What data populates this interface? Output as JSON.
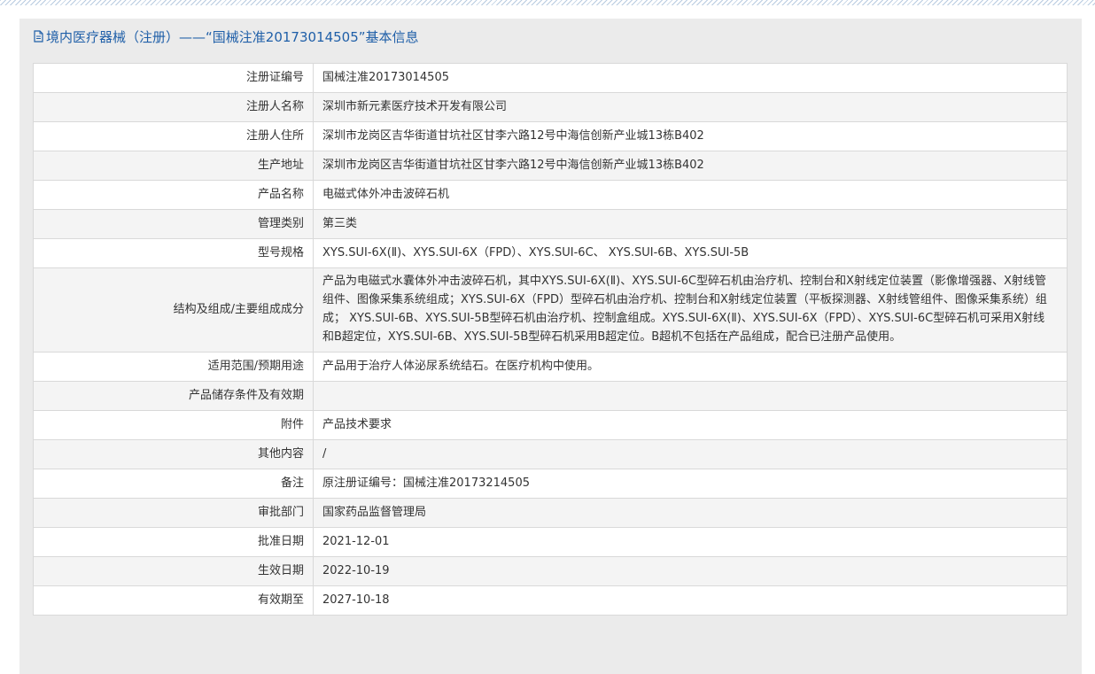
{
  "header": {
    "title": "境内医疗器械（注册）——“国械注准20173014505”基本信息"
  },
  "rows": [
    {
      "label": "注册证编号",
      "value": "国械注准20173014505"
    },
    {
      "label": "注册人名称",
      "value": "深圳市新元素医疗技术开发有限公司"
    },
    {
      "label": "注册人住所",
      "value": "深圳市龙岗区吉华街道甘坑社区甘李六路12号中海信创新产业城13栋B402"
    },
    {
      "label": "生产地址",
      "value": "深圳市龙岗区吉华街道甘坑社区甘李六路12号中海信创新产业城13栋B402"
    },
    {
      "label": "产品名称",
      "value": "电磁式体外冲击波碎石机"
    },
    {
      "label": "管理类别",
      "value": "第三类"
    },
    {
      "label": "型号规格",
      "value": "XYS.SUI-6X(Ⅱ)、XYS.SUI-6X（FPD）、XYS.SUI-6C、 XYS.SUI-6B、XYS.SUI-5B"
    },
    {
      "label": "结构及组成/主要组成成分",
      "value": "产品为电磁式水囊体外冲击波碎石机，其中XYS.SUI-6X(Ⅱ)、XYS.SUI-6C型碎石机由治疗机、控制台和X射线定位装置（影像增强器、X射线管组件、图像采集系统组成；XYS.SUI-6X（FPD）型碎石机由治疗机、控制台和X射线定位装置（平板探测器、X射线管组件、图像采集系统）组成； XYS.SUI-6B、XYS.SUI-5B型碎石机由治疗机、控制盒组成。XYS.SUI-6X(Ⅱ)、XYS.SUI-6X（FPD）、XYS.SUI-6C型碎石机可采用X射线和B超定位，XYS.SUI-6B、XYS.SUI-5B型碎石机采用B超定位。B超机不包括在产品组成，配合已注册产品使用。"
    },
    {
      "label": "适用范围/预期用途",
      "value": "产品用于治疗人体泌尿系统结石。在医疗机构中使用。"
    },
    {
      "label": "产品储存条件及有效期",
      "value": ""
    },
    {
      "label": "附件",
      "value": "产品技术要求"
    },
    {
      "label": "其他内容",
      "value": "/"
    },
    {
      "label": "备注",
      "value": "原注册证编号：国械注准20173214505"
    },
    {
      "label": "审批部门",
      "value": "国家药品监督管理局"
    },
    {
      "label": "批准日期",
      "value": "2021-12-01"
    },
    {
      "label": "生效日期",
      "value": "2022-10-19"
    },
    {
      "label": "有效期至",
      "value": "2027-10-18"
    }
  ]
}
